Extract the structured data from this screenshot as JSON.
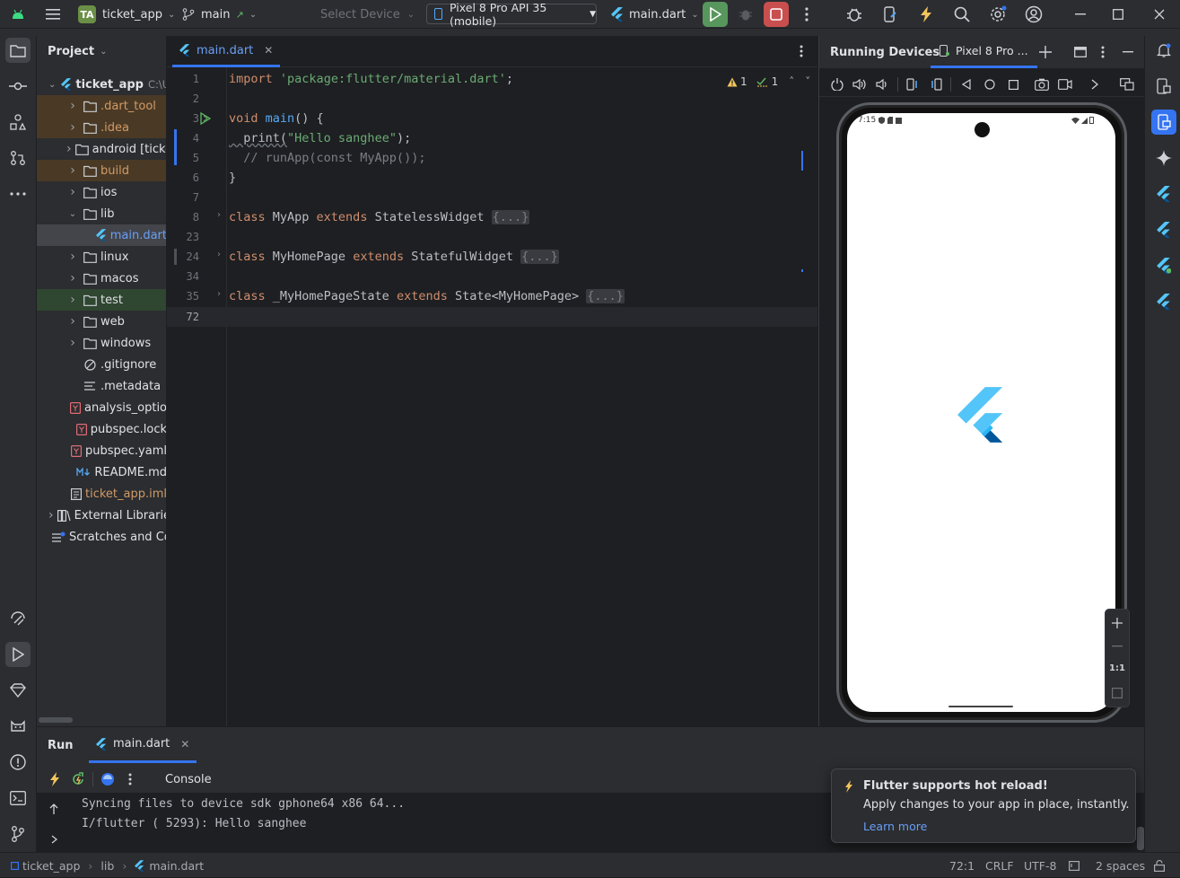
{
  "titlebar": {
    "project_badge": "TA",
    "project_name": "ticket_app",
    "branch": "main",
    "select_device": "Select Device",
    "device": "Pixel 8 Pro API 35 (mobile)",
    "run_config": "main.dart"
  },
  "project_panel": {
    "title": "Project",
    "root_name": "ticket_app",
    "root_path": "C:\\U",
    "items": [
      {
        "label": ".dart_tool",
        "color": "#d19a66"
      },
      {
        "label": ".idea",
        "color": "#d19a66"
      },
      {
        "label": "android [ticke",
        "color": "#dfe1e5"
      },
      {
        "label": "build",
        "color": "#d19a66"
      },
      {
        "label": "ios",
        "color": "#dfe1e5"
      },
      {
        "label": "lib",
        "color": "#dfe1e5"
      },
      {
        "label": "main.dart",
        "color": "#6a9ff7"
      },
      {
        "label": "linux",
        "color": "#dfe1e5"
      },
      {
        "label": "macos",
        "color": "#dfe1e5"
      },
      {
        "label": "test",
        "color": "#dfe1e5"
      },
      {
        "label": "web",
        "color": "#dfe1e5"
      },
      {
        "label": "windows",
        "color": "#dfe1e5"
      },
      {
        "label": ".gitignore",
        "color": "#dfe1e5"
      },
      {
        "label": ".metadata",
        "color": "#dfe1e5"
      },
      {
        "label": "analysis_optio",
        "color": "#dfe1e5"
      },
      {
        "label": "pubspec.lock",
        "color": "#dfe1e5"
      },
      {
        "label": "pubspec.yaml",
        "color": "#dfe1e5"
      },
      {
        "label": "README.md",
        "color": "#dfe1e5"
      },
      {
        "label": "ticket_app.iml",
        "color": "#d19a66"
      },
      {
        "label": "External Libraries",
        "color": "#dfe1e5"
      },
      {
        "label": "Scratches and Co",
        "color": "#dfe1e5"
      }
    ]
  },
  "editor": {
    "tab_label": "main.dart",
    "warning_count": "1",
    "weak_warning_count": "1",
    "line_numbers": [
      "1",
      "2",
      "3",
      "4",
      "5",
      "6",
      "7",
      "8",
      "23",
      "24",
      "34",
      "35",
      "72"
    ],
    "code": {
      "l1_kw": "import",
      "l1_str": "'package:flutter/material.dart'",
      "l1_end": ";",
      "l3_kw": "void",
      "l3_fn": "main",
      "l3_end": "() {",
      "l4_pre": "  print(",
      "l4_str": "\"Hello sanghee\"",
      "l4_end": ");",
      "l5_cmt": "  // runApp(const MyApp());",
      "l6": "}",
      "l8_kw": "class",
      "l8_name": " MyApp ",
      "l8_kw2": "extends",
      "l8_super": " StatelessWidget ",
      "fold": "{...}",
      "l24_kw": "class",
      "l24_name": " MyHomePage ",
      "l24_kw2": "extends",
      "l24_super": " StatefulWidget ",
      "l35_kw": "class",
      "l35_name": " _MyHomePageState ",
      "l35_kw2": "extends",
      "l35_super": " State<MyHomePage> "
    }
  },
  "devices": {
    "title": "Running Devices",
    "tab_label": "Pixel 8 Pro ...",
    "phone_time": "7:15",
    "zoom_ratio": "1:1"
  },
  "run_panel": {
    "title": "Run",
    "tab_label": "main.dart",
    "console_label": "Console",
    "console_lines": [
      "Syncing files to device sdk gphone64 x86 64...",
      "I/flutter ( 5293): Hello sanghee"
    ]
  },
  "popup": {
    "title": "Flutter supports hot reload!",
    "body": "Apply changes to your app in place, instantly.",
    "link": "Learn more"
  },
  "statusbar": {
    "crumbs": [
      "ticket_app",
      "lib",
      "main.dart"
    ],
    "position": "72:1",
    "line_sep": "CRLF",
    "encoding": "UTF-8",
    "indent": "2 spaces"
  }
}
